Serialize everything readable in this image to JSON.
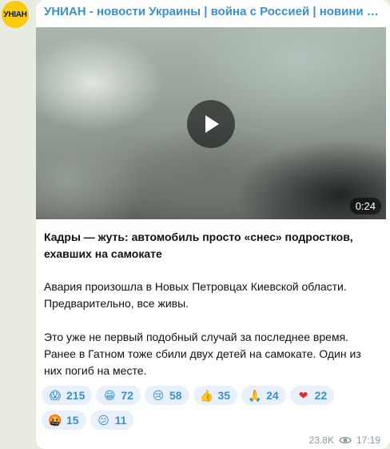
{
  "channel": {
    "avatar_text": "УНІАН",
    "title": "УНИАН - новости Украины | война с Россией | новини України | Украина"
  },
  "video": {
    "duration": "0:24"
  },
  "message": {
    "headline": "Кадры — жуть: автомобиль просто «снес» подростков, ехавших на самокате",
    "paragraph1": "Авария произошла в Новых Петровцах Киевской области. Предварительно, все живы.",
    "paragraph2": "Это уже не первый подобный случай за последнее время. Ранее в Гатном тоже сбили двух детей на самокате. Один из них погиб на месте."
  },
  "reactions": [
    {
      "icon": "screaming-face-icon",
      "glyph": "😱",
      "count": "215"
    },
    {
      "icon": "grinning-face-icon",
      "glyph": "😁",
      "count": "72"
    },
    {
      "icon": "crying-face-icon",
      "glyph": "😢",
      "count": "58"
    },
    {
      "icon": "thumbs-up-icon",
      "glyph": "👍",
      "count": "35"
    },
    {
      "icon": "folded-hands-icon",
      "glyph": "🙏",
      "count": "24"
    },
    {
      "icon": "red-heart-icon",
      "glyph": "❤",
      "count": "22"
    },
    {
      "icon": "angry-face-icon",
      "glyph": "🤬",
      "count": "15"
    },
    {
      "icon": "confused-face-icon",
      "glyph": "😕",
      "count": "11"
    }
  ],
  "meta": {
    "views": "23.8K",
    "time": "17:19"
  },
  "colors": {
    "accent": "#3a90cf",
    "reaction_bg": "#e8f1fb",
    "avatar": "#f8cb0e"
  }
}
